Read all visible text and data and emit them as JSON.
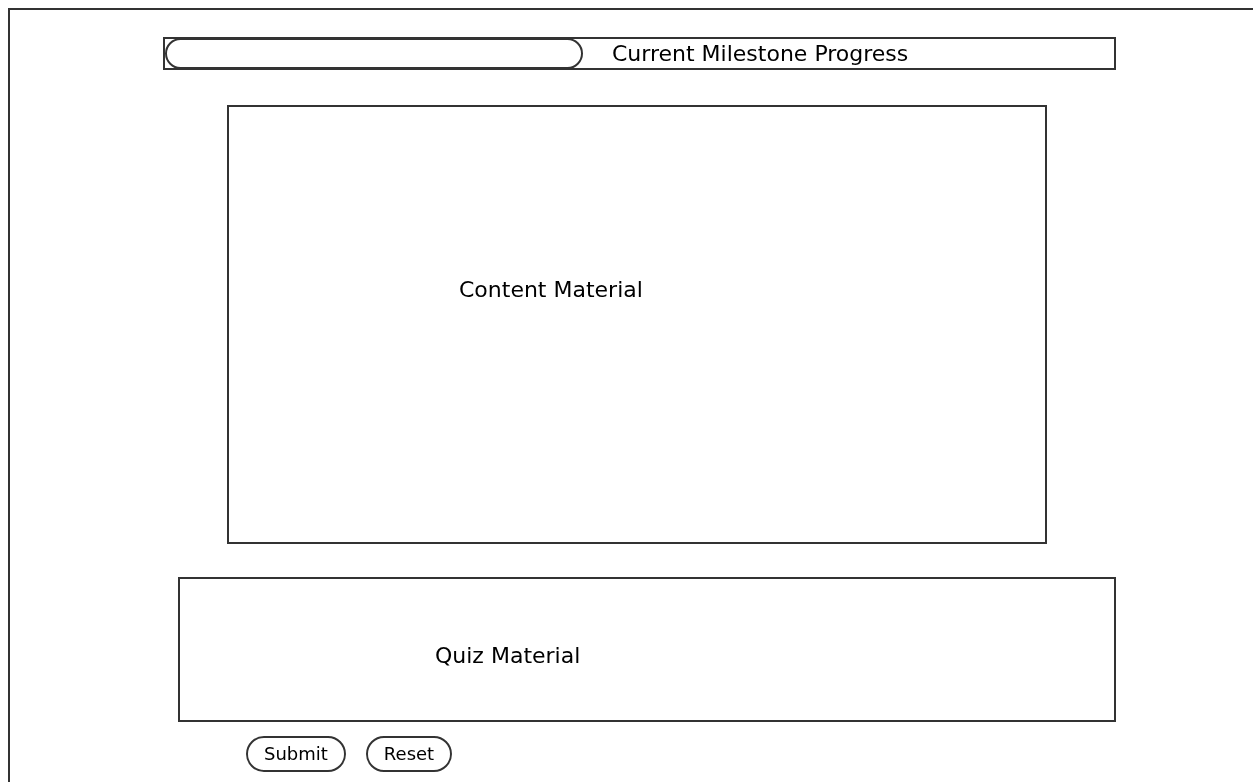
{
  "progress": {
    "level": 0,
    "label": "Current Milestone Progress"
  },
  "content": {
    "label": "Content Material"
  },
  "quiz": {
    "label": "Quiz Material"
  },
  "buttons": [
    "Submit",
    "Reset"
  ]
}
